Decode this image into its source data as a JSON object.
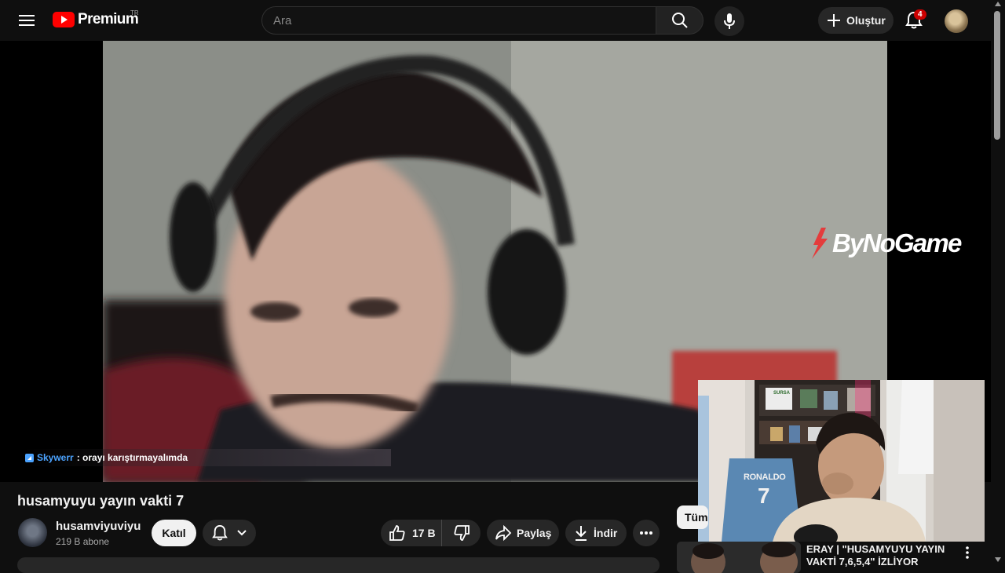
{
  "header": {
    "logo_text": "Premium",
    "logo_region": "TR",
    "search_placeholder": "Ara",
    "create_label": "Oluştur",
    "notification_count": "4",
    "icons": [
      "menu-icon",
      "youtube-logo-icon",
      "search-icon",
      "microphone-icon",
      "plus-icon",
      "bell-icon"
    ]
  },
  "player": {
    "chat_user": "Skywerr",
    "chat_message": ": orayı karıştırmayalımda",
    "watermark": "ByNoGame",
    "overlay_jersey_name": "RONALDO",
    "overlay_jersey_number": "7",
    "overlay_shelf_label": "SURSA"
  },
  "video": {
    "title": "husamyuyu yayın vakti 7",
    "channel_name": "husamviyuviyu",
    "subscribers": "219 B abone",
    "join_label": "Katıl",
    "like_count": "17 B",
    "share_label": "Paylaş",
    "download_label": "İndir"
  },
  "sidebar": {
    "chip_label": "Tümü",
    "recommendation_title": "ERAY | \"HUSAMYUYU YAYIN VAKTİ 7,6,5,4\" İZLİYOR"
  },
  "colors": {
    "background": "#0f0f0f",
    "button_bg": "#272727",
    "brand_red": "#ff0000",
    "chat_user_blue": "#4ca3ff",
    "badge_red": "#cc0000"
  }
}
